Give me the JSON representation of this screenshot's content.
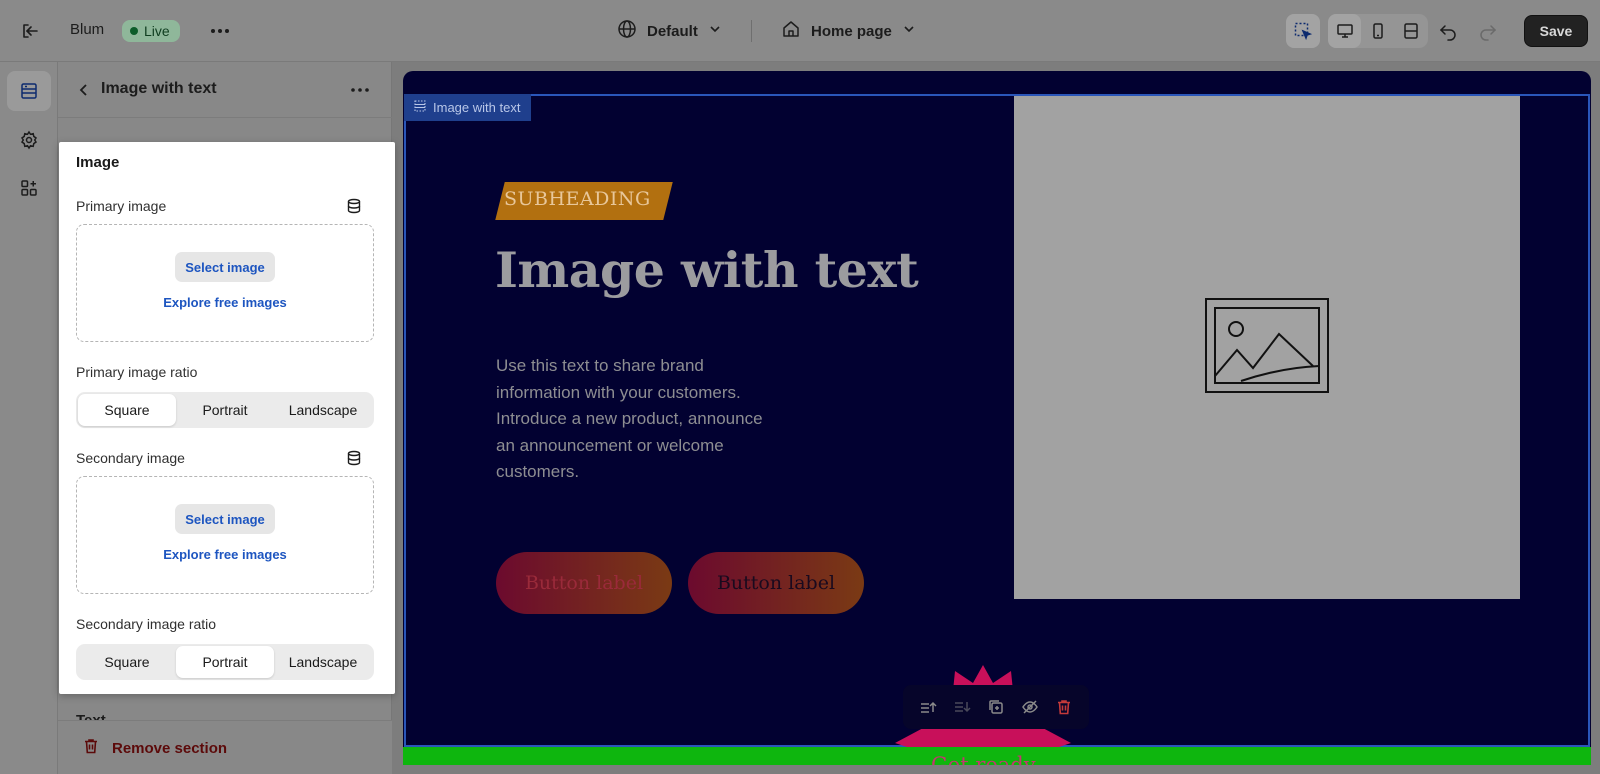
{
  "topbar": {
    "theme_name": "Blum",
    "status_badge": "Live",
    "theme_selector": "Default",
    "page_selector": "Home page",
    "save_label": "Save"
  },
  "panel": {
    "title": "Image with text",
    "next_group_label": "Text",
    "remove_label": "Remove section"
  },
  "settings_card": {
    "title": "Image",
    "primary_image_label": "Primary image",
    "primary_select_label": "Select image",
    "primary_explore_label": "Explore free images",
    "primary_ratio_label": "Primary image ratio",
    "primary_ratio_options": [
      "Square",
      "Portrait",
      "Landscape"
    ],
    "primary_ratio_selected": "Square",
    "secondary_image_label": "Secondary image",
    "secondary_select_label": "Select image",
    "secondary_explore_label": "Explore free images",
    "secondary_ratio_label": "Secondary image ratio",
    "secondary_ratio_options": [
      "Square",
      "Portrait",
      "Landscape"
    ],
    "secondary_ratio_selected": "Portrait"
  },
  "preview": {
    "section_tag": "Image with text",
    "subheading": "SUBHEADING",
    "heading": "Image with text",
    "body": "Use this text to share brand information with your customers. Introduce a new product, announce an announcement or welcome customers.",
    "button1_label": "Button label",
    "button2_label": "Button label",
    "next_section_text": "Get ready"
  },
  "colors": {
    "preview_bg": "#020131",
    "accent_blue": "#1d55c0",
    "section_outline": "#2a56ba",
    "subheading_bg": "#b27010",
    "green_bar": "#0eb60e",
    "danger": "#5c0a0a"
  }
}
